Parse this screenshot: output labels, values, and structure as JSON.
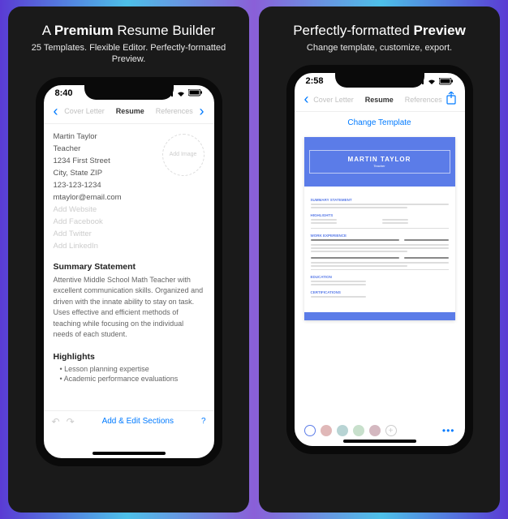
{
  "card1": {
    "headline_pre": "A ",
    "headline_bold": "Premium",
    "headline_post": " Resume Builder",
    "subhead": "25 Templates. Flexible Editor. Perfectly-formatted Preview.",
    "time": "8:40",
    "tabs": {
      "cover": "Cover Letter",
      "resume": "Resume",
      "refs": "References"
    },
    "fields": {
      "name": "Martin Taylor",
      "title": "Teacher",
      "address1": "1234 First Street",
      "address2": "City, State ZIP",
      "phone": "123-123-1234",
      "email": "mtaylor@email.com",
      "website": "Add Website",
      "facebook": "Add Facebook",
      "twitter": "Add Twitter",
      "linkedin": "Add LinkedIn",
      "addimage": "Add Image"
    },
    "summary_title": "Summary Statement",
    "summary_text": "Attentive Middle School Math Teacher with excellent communication skills. Organized and driven with the innate ability to stay on task. Uses effective and efficient methods of teaching while focusing on the individual needs of each student.",
    "highlights_title": "Highlights",
    "highlights": [
      "Lesson planning expertise",
      "Academic performance evaluations"
    ],
    "footer_link": "Add & Edit Sections",
    "footer_help": "?"
  },
  "card2": {
    "headline_pre": "Perfectly-formatted ",
    "headline_bold": "Preview",
    "headline_post": "",
    "subhead": "Change template, customize, export.",
    "time": "2:58",
    "tabs": {
      "cover": "Cover Letter",
      "resume": "Resume",
      "refs": "References"
    },
    "change_template": "Change Template",
    "preview": {
      "name": "MARTIN TAYLOR",
      "role": "Teacher",
      "sections": [
        "SUMMARY STATEMENT",
        "HIGHLIGHTS",
        "WORK EXPERIENCE",
        "EDUCATION",
        "CERTIFICATIONS"
      ]
    },
    "swatches": [
      "#5b7ce8",
      "#e0b8b8",
      "#b8d4d4",
      "#c8e0cc",
      "#d4b8c0"
    ],
    "more": "•••"
  }
}
